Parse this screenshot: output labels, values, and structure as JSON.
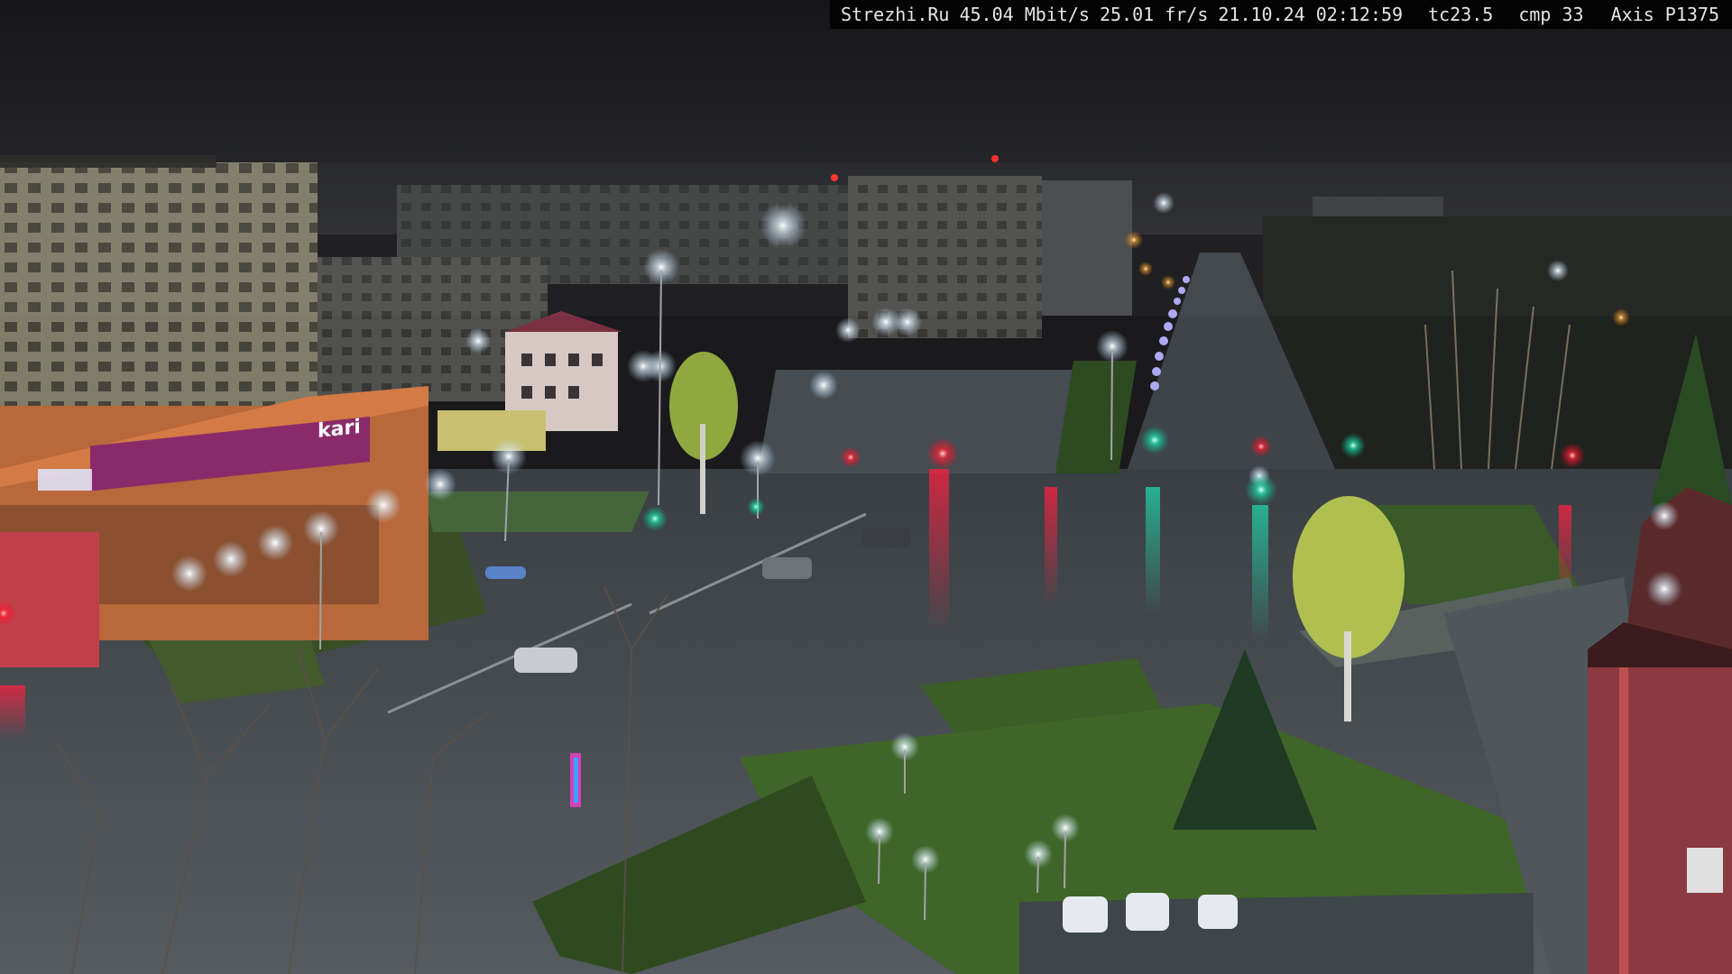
{
  "overlay": {
    "site": "Strezhi.Ru",
    "bandwidth": "45.04 Mbit/s",
    "framerate": "25.01 fr/s",
    "datetime": "21.10.24 02:12:59",
    "temperature": "tc23.5",
    "compression": "cmp 33",
    "camera": "Axis P1375"
  },
  "signs": {
    "store_name": "kari",
    "store_name_lower": "kari"
  },
  "palette": {
    "sky": "#1b1b1e",
    "asphalt_wet": "#4c5258",
    "grass": "#3c5a28",
    "lamp": "#eaf4ff",
    "traffic_red": "#ff2a3a",
    "traffic_green": "#29e0b0",
    "store_facade": "#c9733d",
    "store_sign": "#8a2a6a"
  }
}
